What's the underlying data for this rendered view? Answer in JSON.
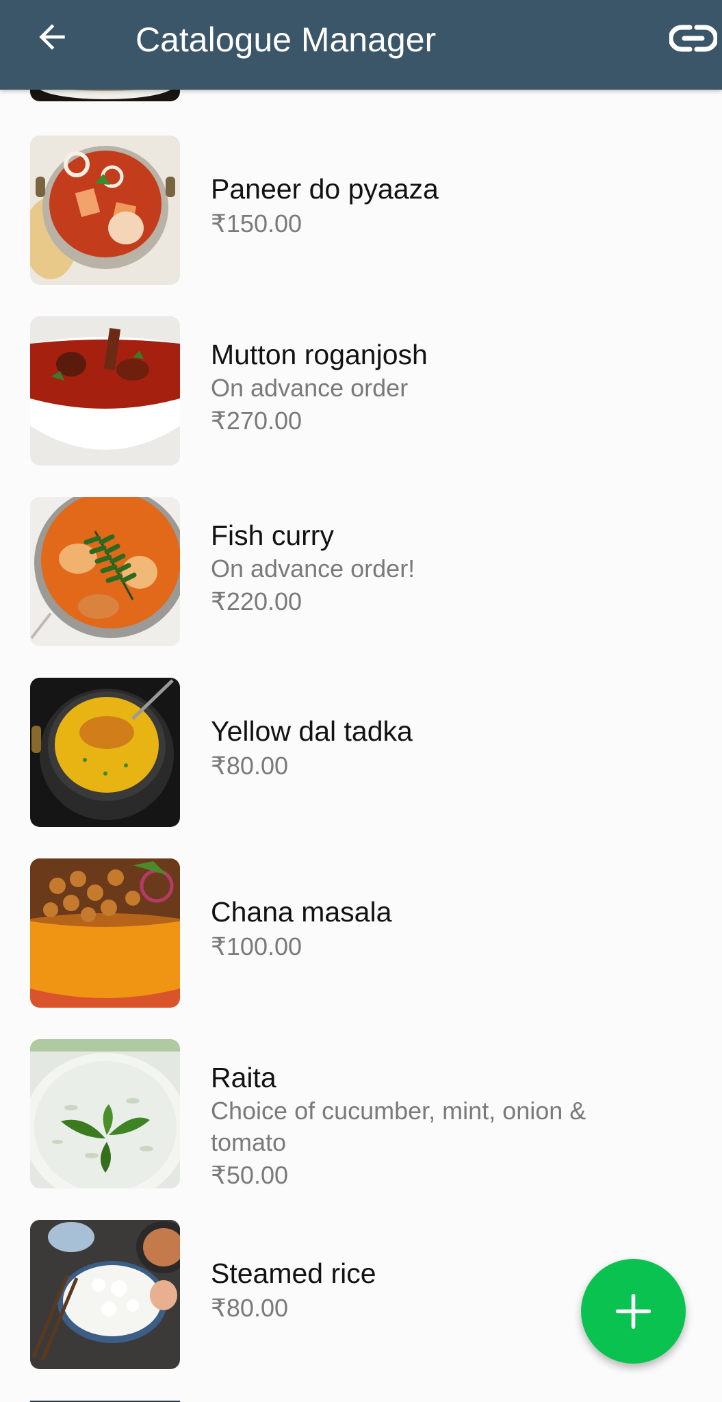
{
  "header": {
    "title": "Catalogue Manager",
    "back_icon": "arrow-left-icon",
    "link_icon": "link-icon",
    "background": "#3b5668"
  },
  "products": [
    {
      "name": "Paneer do pyaaza",
      "price": "₹150.00"
    },
    {
      "name": "Mutton roganjosh",
      "description": "On advance order",
      "price": "₹270.00"
    },
    {
      "name": "Fish curry",
      "description": "On advance order!",
      "price": "₹220.00"
    },
    {
      "name": "Yellow dal tadka",
      "price": "₹80.00"
    },
    {
      "name": "Chana masala",
      "price": "₹100.00"
    },
    {
      "name": "Raita",
      "description": "Choice of cucumber, mint, onion & tomato",
      "price": "₹50.00"
    },
    {
      "name": "Steamed rice",
      "price": "₹80.00"
    }
  ],
  "fab": {
    "icon": "plus-icon",
    "color": "#0ac24f"
  }
}
